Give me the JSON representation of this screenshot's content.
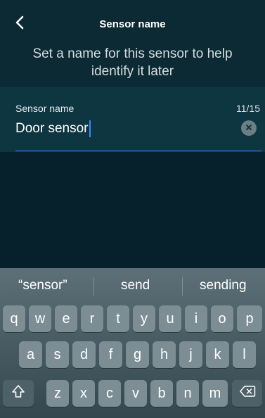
{
  "header": {
    "title": "Sensor name",
    "subtitle": "Set a name for this sensor to help identify it later"
  },
  "field": {
    "label": "Sensor name",
    "value": "Door sensor",
    "counter": "11/15"
  },
  "keyboard": {
    "suggestions": [
      "“sensor”",
      "send",
      "sending"
    ],
    "row1": [
      "q",
      "w",
      "e",
      "r",
      "t",
      "y",
      "u",
      "i",
      "o",
      "p"
    ],
    "row2": [
      "a",
      "s",
      "d",
      "f",
      "g",
      "h",
      "j",
      "k",
      "l"
    ],
    "row3": [
      "z",
      "x",
      "c",
      "v",
      "b",
      "n",
      "m"
    ]
  },
  "icons": {
    "back": "chevron-left-icon",
    "clear": "clear-circle-icon",
    "shift": "shift-icon",
    "backspace": "backspace-icon"
  },
  "colors": {
    "background": "#06212b",
    "accent": "#2f86ff",
    "caret": "#3b87ff"
  }
}
